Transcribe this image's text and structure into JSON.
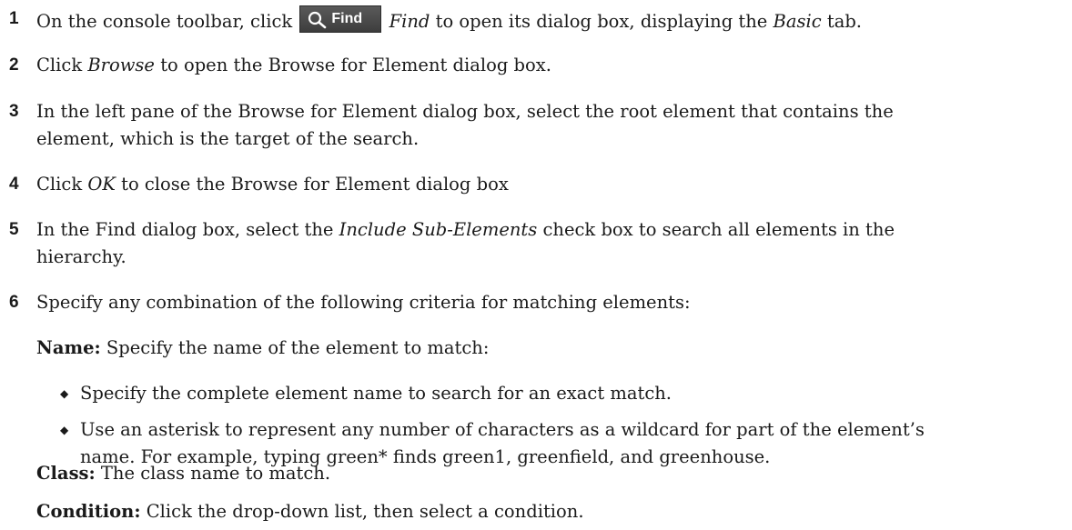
{
  "steps": [
    {
      "num": "1",
      "pre": "On the console toolbar, click",
      "button_label": "Find",
      "em1": "Find",
      "mid": "to open its dialog box, displaying the",
      "em2": "Basic",
      "post": "tab."
    },
    {
      "num": "2",
      "pre": "Click",
      "em1": "Browse",
      "post": "to open the Browse for Element dialog box."
    },
    {
      "num": "3",
      "line1": "In the left pane of the Browse for Element dialog box, select the root element that contains the",
      "line2": "element, which is the target of the search."
    },
    {
      "num": "4",
      "pre": "Click",
      "em1": "OK",
      "post": "to close the Browse for Element dialog box"
    },
    {
      "num": "5",
      "pre": "In the Find dialog box, select the",
      "em1": "Include Sub-Elements",
      "post": "check box to search all elements in the",
      "line2": "hierarchy."
    },
    {
      "num": "6",
      "text": "Specify any combination of the following criteria for matching elements:"
    }
  ],
  "name_criterion": {
    "term": "Name:",
    "desc": "Specify the name of the element to match:"
  },
  "bullets": [
    {
      "line1": "Specify the complete element name to search for an exact match."
    },
    {
      "line1": "Use an asterisk to represent any number of characters as a wildcard for part of the element’s",
      "line2": "name. For example, typing green* finds green1, greenfield, and greenhouse."
    }
  ],
  "class_criterion": {
    "term": "Class:",
    "desc": "The class name to match."
  },
  "condition_criterion": {
    "term": "Condition:",
    "desc": "Click the drop-down list, then select a condition."
  },
  "icons": {
    "find_button_icon": "search-icon",
    "bullet_icon": "diamond-bullet"
  },
  "colors": {
    "text": "#1a1a1a",
    "button_bg": "#4a4a4a",
    "button_text": "#ffffff"
  }
}
